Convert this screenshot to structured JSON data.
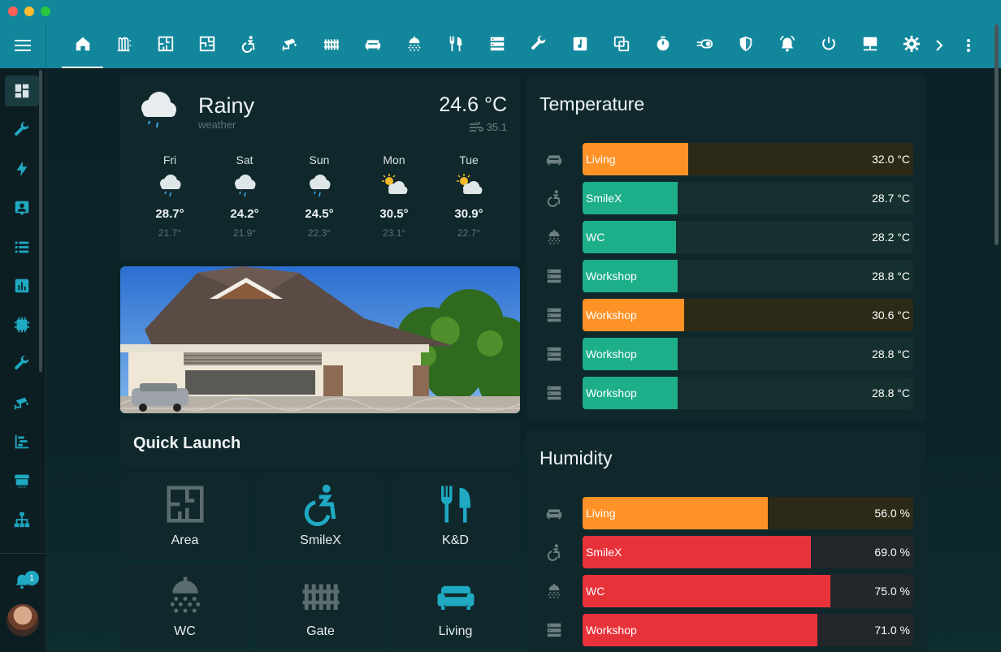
{
  "colors": {
    "accent": "#12879c",
    "orange": "#ff9227",
    "teal": "#1daf8a",
    "red": "#e8323a",
    "track_orange": "#2c2a16",
    "track_teal": "#15302f",
    "track_red": "#23262a"
  },
  "topbar": {
    "tabs": [
      {
        "name": "home-icon",
        "active": true
      },
      {
        "name": "radiator-icon"
      },
      {
        "name": "floor-plan-icon"
      },
      {
        "name": "floor-plan-alt-icon"
      },
      {
        "name": "wheelchair-icon"
      },
      {
        "name": "cctv-icon"
      },
      {
        "name": "fence-icon"
      },
      {
        "name": "sofa-icon"
      },
      {
        "name": "shower-icon"
      },
      {
        "name": "silverware-icon"
      },
      {
        "name": "server-icon"
      },
      {
        "name": "wrench-icon"
      },
      {
        "name": "music-icon"
      },
      {
        "name": "copy-icon"
      },
      {
        "name": "timer-icon"
      },
      {
        "name": "toggle-icon"
      },
      {
        "name": "shield-icon"
      },
      {
        "name": "alarm-bell-icon"
      },
      {
        "name": "power-icon"
      },
      {
        "name": "desktop-icon"
      },
      {
        "name": "gear-icon"
      }
    ]
  },
  "sidebar": {
    "notification_count": "1"
  },
  "weather": {
    "condition": "Rainy",
    "subtitle": "weather",
    "temperature": "24.6 °C",
    "wind": "35.1",
    "forecast": [
      {
        "day": "Fri",
        "hi": "28.7°",
        "lo": "21.7°",
        "icon": "rain"
      },
      {
        "day": "Sat",
        "hi": "24.2°",
        "lo": "21.9°",
        "icon": "rain"
      },
      {
        "day": "Sun",
        "hi": "24.5°",
        "lo": "22.3°",
        "icon": "rain"
      },
      {
        "day": "Mon",
        "hi": "30.5°",
        "lo": "23.1°",
        "icon": "partly-cloudy"
      },
      {
        "day": "Tue",
        "hi": "30.9°",
        "lo": "22.7°",
        "icon": "partly-cloudy"
      }
    ]
  },
  "quick_launch": {
    "title": "Quick Launch",
    "items": [
      {
        "label": "Area",
        "icon": "floor-plan-icon"
      },
      {
        "label": "SmileX",
        "icon": "wheelchair-icon"
      },
      {
        "label": "K&D",
        "icon": "silverware-icon"
      },
      {
        "label": "WC",
        "icon": "shower-icon"
      },
      {
        "label": "Gate",
        "icon": "fence-icon"
      },
      {
        "label": "Living",
        "icon": "sofa-icon"
      }
    ]
  },
  "temperature": {
    "title": "Temperature",
    "rows": [
      {
        "label": "Living",
        "value": "32.0 °C",
        "fraction": 0.32,
        "color": "orange",
        "icon": "sofa-icon"
      },
      {
        "label": "SmileX",
        "value": "28.7 °C",
        "fraction": 0.287,
        "color": "teal",
        "icon": "wheelchair-icon"
      },
      {
        "label": "WC",
        "value": "28.2 °C",
        "fraction": 0.282,
        "color": "teal",
        "icon": "shower-icon"
      },
      {
        "label": "Workshop",
        "value": "28.8 °C",
        "fraction": 0.288,
        "color": "teal",
        "icon": "server-icon"
      },
      {
        "label": "Workshop",
        "value": "30.6 °C",
        "fraction": 0.306,
        "color": "orange",
        "icon": "server-icon"
      },
      {
        "label": "Workshop",
        "value": "28.8 °C",
        "fraction": 0.288,
        "color": "teal",
        "icon": "server-icon"
      },
      {
        "label": "Workshop",
        "value": "28.8 °C",
        "fraction": 0.288,
        "color": "teal",
        "icon": "server-icon"
      }
    ]
  },
  "humidity": {
    "title": "Humidity",
    "rows": [
      {
        "label": "Living",
        "value": "56.0 %",
        "fraction": 0.56,
        "color": "orange",
        "icon": "sofa-icon"
      },
      {
        "label": "SmileX",
        "value": "69.0 %",
        "fraction": 0.69,
        "color": "red",
        "icon": "wheelchair-icon"
      },
      {
        "label": "WC",
        "value": "75.0 %",
        "fraction": 0.75,
        "color": "red",
        "icon": "shower-icon"
      },
      {
        "label": "Workshop",
        "value": "71.0 %",
        "fraction": 0.71,
        "color": "red",
        "icon": "server-icon"
      }
    ]
  }
}
